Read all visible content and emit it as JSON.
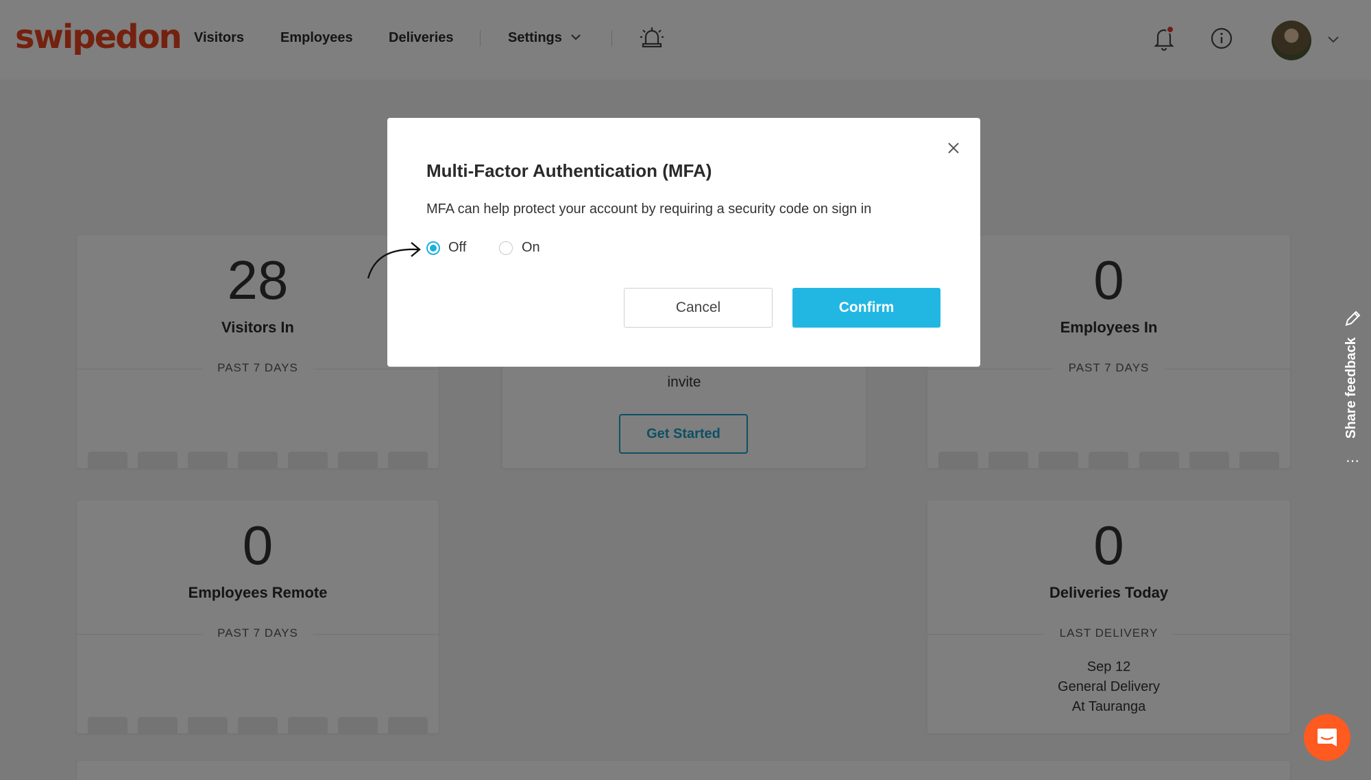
{
  "header": {
    "logo_text": "swipedon",
    "nav": [
      "Visitors",
      "Employees",
      "Deliveries",
      "Settings"
    ]
  },
  "cards": {
    "visitors_in": {
      "count": "28",
      "label": "Visitors In",
      "sub": "PAST 7 DAYS"
    },
    "employees_in": {
      "count": "0",
      "label": "Employees In",
      "sub": "PAST 7 DAYS"
    },
    "employees_remote": {
      "count": "0",
      "label": "Employees Remote",
      "sub": "PAST 7 DAYS"
    },
    "deliveries_today": {
      "count": "0",
      "label": "Deliveries Today",
      "sub": "LAST DELIVERY",
      "line1": "Sep 12",
      "line2": "General Delivery",
      "line3": "At Tauranga"
    },
    "invite": {
      "text": "invite",
      "button": "Get Started"
    }
  },
  "feedback": {
    "label": "Share feedback"
  },
  "modal": {
    "title": "Multi-Factor Authentication (MFA)",
    "description": "MFA can help protect your account by requiring a security code on sign in",
    "option_off": "Off",
    "option_on": "On",
    "selected": "Off",
    "cancel": "Cancel",
    "confirm": "Confirm"
  },
  "colors": {
    "brand": "#e8431f",
    "accent": "#22b7e3",
    "chat": "#ff5a1f"
  }
}
